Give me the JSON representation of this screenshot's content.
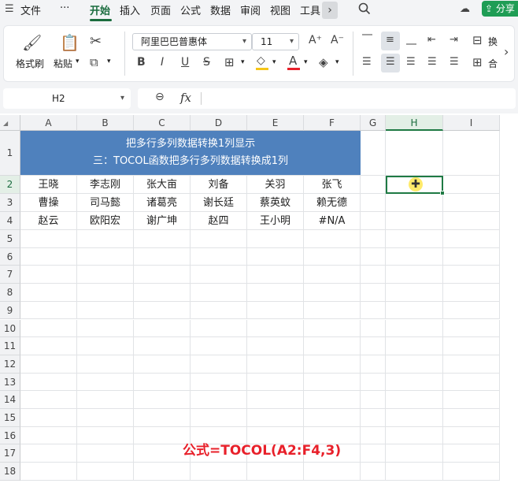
{
  "menu": {
    "file": "文件",
    "more": "···",
    "tabs": [
      "开始",
      "插入",
      "页面",
      "公式",
      "数据",
      "审阅",
      "视图",
      "工具"
    ],
    "active_tab": "开始",
    "expand": "›",
    "share": "分享"
  },
  "ribbon": {
    "format_painter": "格式刷",
    "paste": "粘贴",
    "font_name": "阿里巴巴普惠体",
    "font_size": "11",
    "increase_font": "A⁺",
    "decrease_font": "A⁻",
    "bold": "B",
    "italic": "I",
    "underline": "U",
    "strikethrough": "S",
    "wrap_label": "换",
    "merge_label": "合",
    "expand_arrow": "›",
    "font_color": "#e8202a",
    "fill_color": "#f5c518"
  },
  "formula_bar": {
    "name_box": "H2",
    "fx": "fx",
    "formula": ""
  },
  "sheet": {
    "columns": [
      "A",
      "B",
      "C",
      "D",
      "E",
      "F",
      "G",
      "H",
      "I"
    ],
    "selected_column": "H",
    "rows": [
      "1",
      "2",
      "3",
      "4",
      "5",
      "6",
      "7",
      "8",
      "9",
      "10",
      "11",
      "12",
      "13",
      "14",
      "15",
      "16",
      "17",
      "18"
    ],
    "selected_row": "2",
    "title_line1": "把多行多列数据转换1列显示",
    "title_line2": "三：TOCOL函数把多行多列数据转换成1列",
    "title_bg": "#4f81bd",
    "data": [
      [
        "王晓",
        "李志刚",
        "张大亩",
        "刘备",
        "关羽",
        "张飞"
      ],
      [
        "曹操",
        "司马懿",
        "诸葛亮",
        "谢长廷",
        "蔡英蚊",
        "赖无德"
      ],
      [
        "赵云",
        "欧阳宏",
        "谢广坤",
        "赵四",
        "王小明",
        "#N/A"
      ]
    ],
    "active_cell": "H2",
    "note": "公式=TOCOL(A2:F4,3)",
    "note_color": "#e8202a"
  }
}
